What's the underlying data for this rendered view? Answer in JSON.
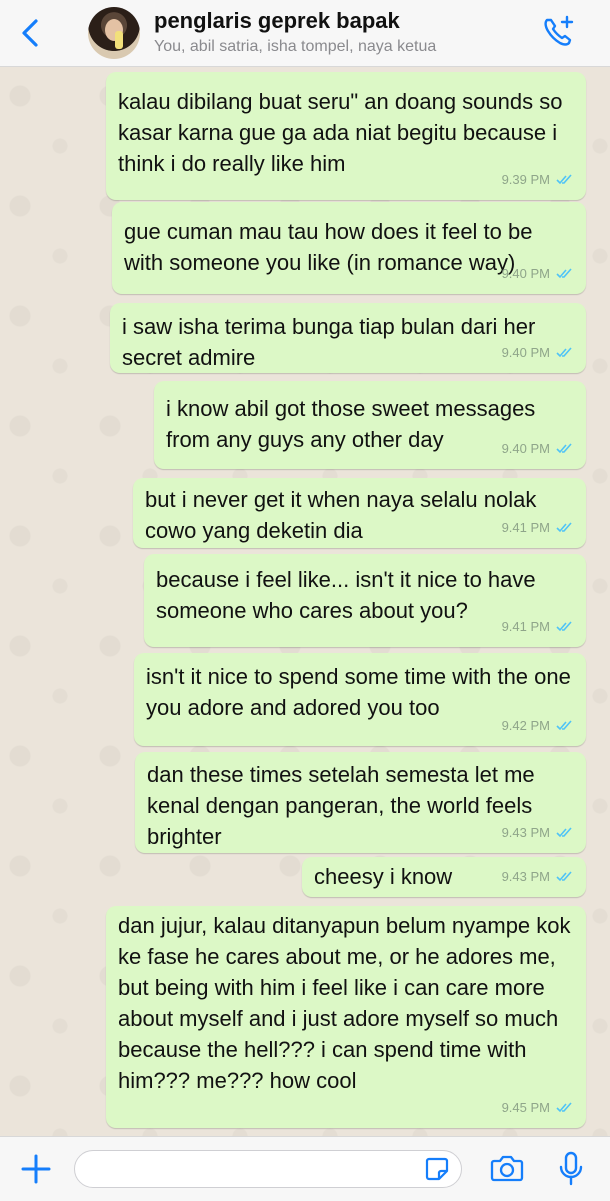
{
  "header": {
    "title": "penglaris geprek bapak",
    "subtitle": "You, abil satria, isha tompel, naya ketua"
  },
  "colors": {
    "accent": "#157efb",
    "bubble": "#dcf8c6",
    "read_ticks": "#4fc3f7"
  },
  "messages": [
    {
      "text": "kalau dibilang buat seru\" an doang sounds so kasar karna gue ga ada niat begitu because i think i do really like him",
      "time": "9.39 PM",
      "status": "read"
    },
    {
      "text": "gue cuman mau tau how does it feel to be with someone you like (in romance way)",
      "time": "9.40 PM",
      "status": "read"
    },
    {
      "text": "i saw isha terima bunga tiap bulan dari her secret admire",
      "time": "9.40 PM",
      "status": "read"
    },
    {
      "text": "i know abil got those sweet messages from any guys any other day",
      "time": "9.40 PM",
      "status": "read"
    },
    {
      "text": "but i never get it when naya selalu nolak cowo yang deketin dia",
      "time": "9.41 PM",
      "status": "read"
    },
    {
      "text": "because i feel like... isn't it nice to have someone who cares about you?",
      "time": "9.41 PM",
      "status": "read"
    },
    {
      "text": "isn't it nice to spend some time with the one you adore and adored you too",
      "time": "9.42 PM",
      "status": "read"
    },
    {
      "text": "dan these times setelah semesta let me kenal dengan pangeran, the world feels brighter",
      "time": "9.43 PM",
      "status": "read"
    },
    {
      "text": "cheesy i know",
      "time": "9.43 PM",
      "status": "read"
    },
    {
      "text": "dan jujur, kalau ditanyapun belum nyampe kok ke fase he cares about me, or he adores me, but being with him i feel like i can care more about myself and i just adore myself so much because the hell??? i can spend time with him??? me??? how cool",
      "time": "9.45 PM",
      "status": "read"
    }
  ],
  "icons": {
    "back": "chevron-left-icon",
    "call": "phone-plus-icon",
    "attach": "plus-icon",
    "sticker": "sticker-icon",
    "camera": "camera-icon",
    "mic": "microphone-icon"
  },
  "input": {
    "value": ""
  }
}
